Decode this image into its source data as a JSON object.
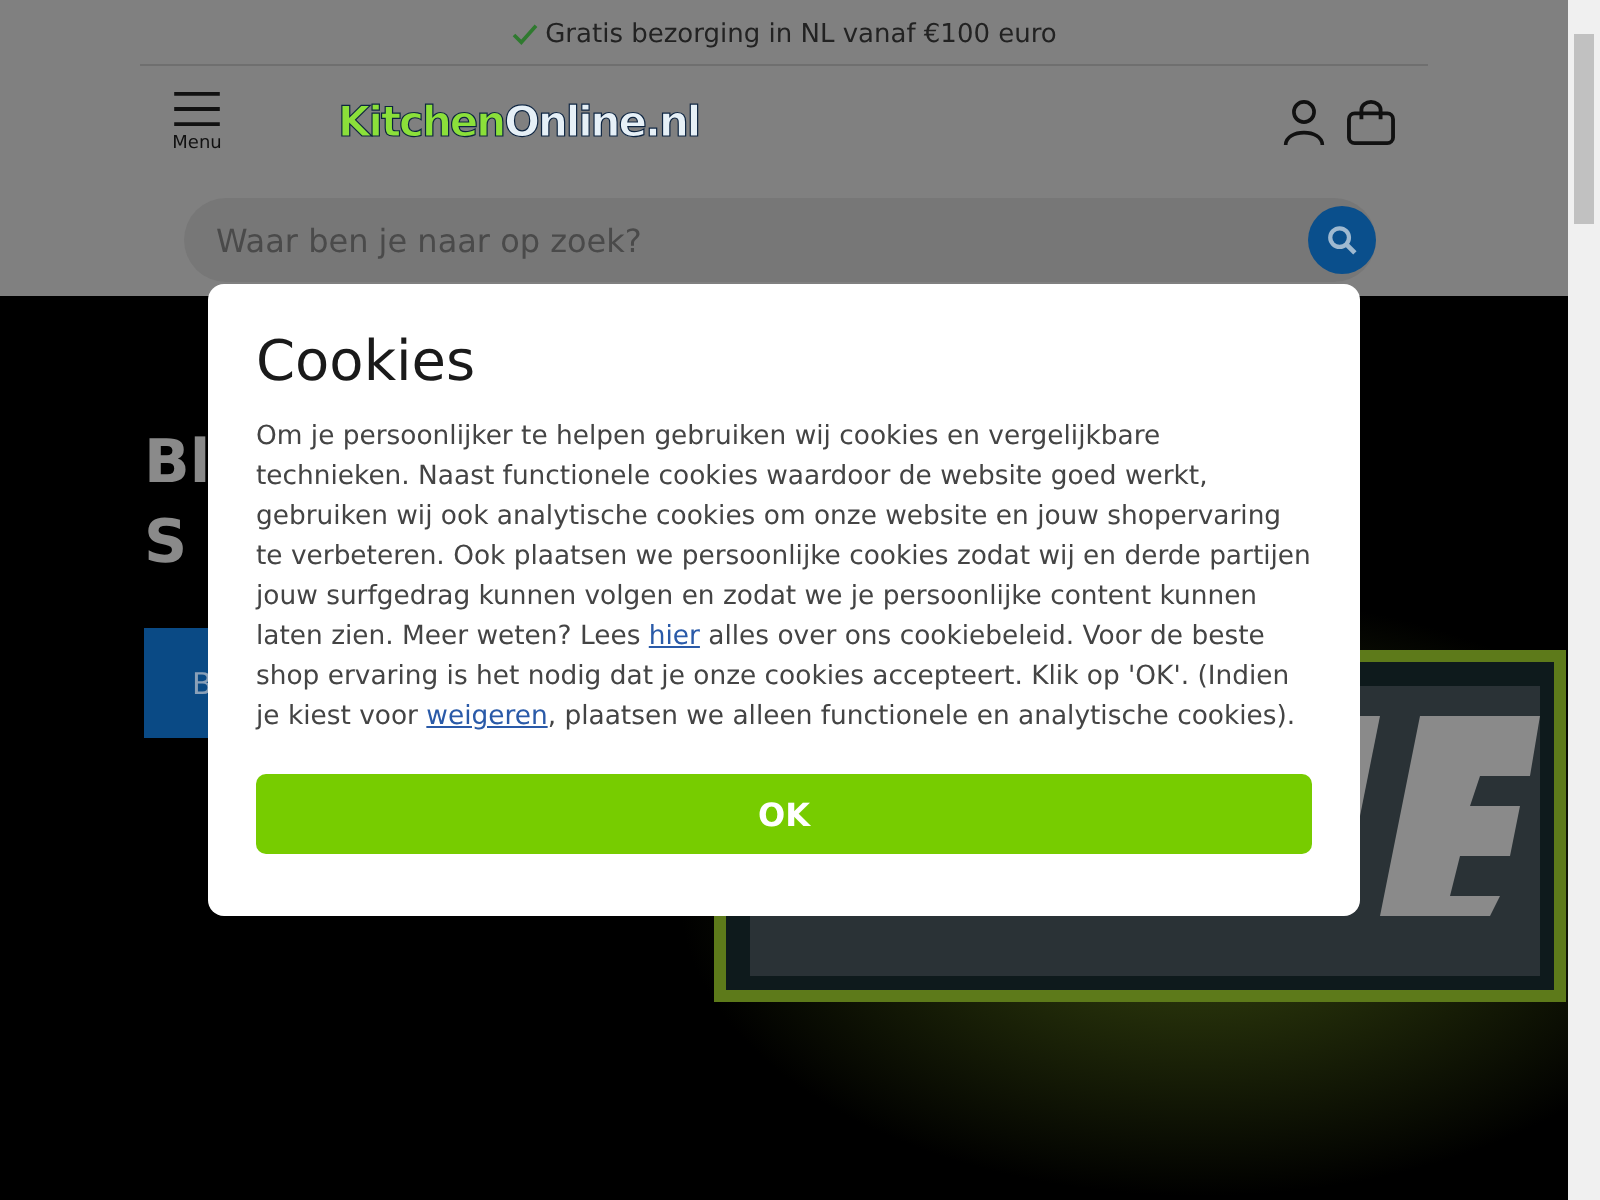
{
  "topbar": {
    "text": "Gratis bezorging in NL vanaf €100 euro"
  },
  "header": {
    "menu_label": "Menu",
    "logo": {
      "part1": "Kitchen",
      "part2": "Online.nl"
    }
  },
  "search": {
    "placeholder": "Waar ben je naar op zoek?"
  },
  "hero": {
    "kind": "picture",
    "title_lines": [
      "Bl",
      "S"
    ],
    "button": "B"
  },
  "cookie_dialog": {
    "title": "Cookies",
    "text_before": "Om je persoonlijker te helpen gebruiken wij cookies en vergelijkbare technieken. Naast functionele cookies waardoor de website goed werkt, gebruiken wij ook analytische cookies om onze website en jouw shopervaring te verbeteren. Ook plaatsen we persoonlijke cookies zodat wij en derde partijen jouw surfgedrag kunnen volgen en zodat we je persoonlijke content kunnen laten zien. Meer weten? Lees ",
    "link_1": "hier",
    "text_middle": " alles over ons cookiebeleid. Voor de beste shop ervaring is het nodig dat je onze cookies accepteert. Klik op 'OK'. (Indien je kiest voor ",
    "link_2": "weigeren",
    "text_after": ", plaatsen we alleen functionele en analytische cookies).",
    "button": "OK"
  }
}
